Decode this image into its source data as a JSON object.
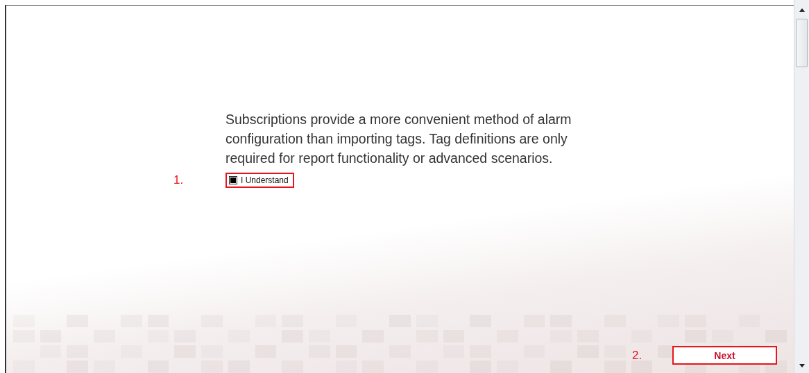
{
  "message": "Subscriptions provide a more convenient method of alarm configuration than importing tags. Tag definitions are only required for report functionality or advanced scenarios.",
  "agreement": {
    "marker": "1.",
    "label": "I Understand",
    "checked": true
  },
  "next": {
    "marker": "2.",
    "label": "Next"
  }
}
